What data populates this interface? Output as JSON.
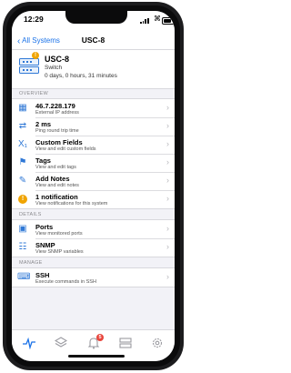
{
  "status_bar": {
    "time": "12:29"
  },
  "nav": {
    "back_label": "All Systems",
    "title": "USC-8"
  },
  "device": {
    "name": "USC-8",
    "type": "Switch",
    "uptime": "0 days, 0 hours, 31 minutes",
    "badge": "!"
  },
  "sections": {
    "overview": {
      "label": "OVERVIEW",
      "rows": [
        {
          "title": "46.7.228.179",
          "subtitle": "External IP address",
          "icon": "network-icon"
        },
        {
          "title": "2 ms",
          "subtitle": "Ping round trip time",
          "icon": "ping-arrows-icon"
        },
        {
          "title": "Custom Fields",
          "subtitle": "View and edit custom fields",
          "icon": "custom-fields-icon"
        },
        {
          "title": "Tags",
          "subtitle": "View and edit tags",
          "icon": "tag-icon"
        },
        {
          "title": "Add Notes",
          "subtitle": "View and edit notes",
          "icon": "notes-icon"
        },
        {
          "title": "1 notification",
          "subtitle": "View notifications for this system",
          "icon": "warning-icon",
          "marker": "!"
        }
      ]
    },
    "details": {
      "label": "DETAILS",
      "rows": [
        {
          "title": "Ports",
          "subtitle": "View monitored ports",
          "icon": "ports-icon"
        },
        {
          "title": "SNMP",
          "subtitle": "View SNMP variables",
          "icon": "snmp-icon"
        }
      ]
    },
    "manage": {
      "label": "MANAGE",
      "rows": [
        {
          "title": "SSH",
          "subtitle": "Execute commands in SSH",
          "icon": "terminal-icon"
        }
      ]
    }
  },
  "tabbar": {
    "items": [
      {
        "name": "activity-icon",
        "active": true
      },
      {
        "name": "layers-icon",
        "active": false
      },
      {
        "name": "bell-icon",
        "active": false,
        "badge": "5"
      },
      {
        "name": "server-list-icon",
        "active": false
      },
      {
        "name": "settings-gear-icon",
        "active": false
      }
    ]
  },
  "colors": {
    "accent": "#1a72e8",
    "warning": "#f0a400",
    "badge_red": "#e8453c",
    "background": "#f2f2f7"
  }
}
